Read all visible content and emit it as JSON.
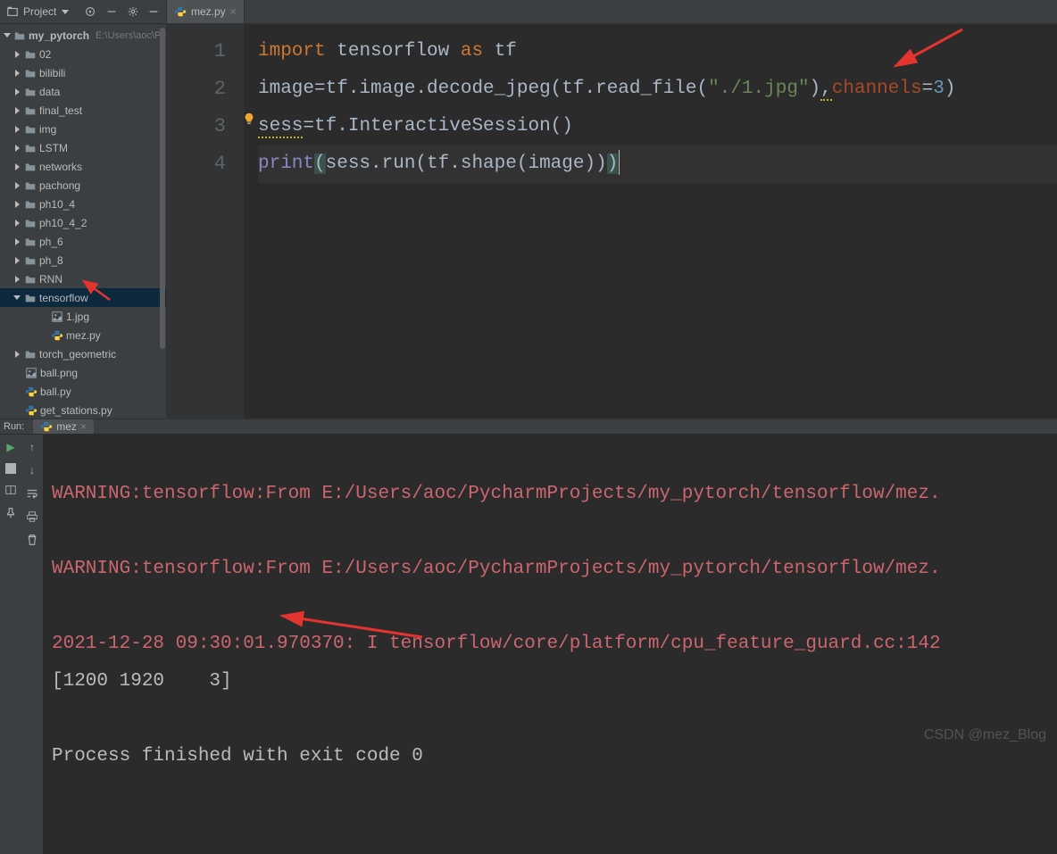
{
  "sidebar": {
    "headerLabel": "Project",
    "root": {
      "name": "my_pytorch",
      "path": "E:\\Users\\aoc\\Pyc"
    },
    "folders_root_level": [
      "02",
      "bilibili",
      "data",
      "final_test",
      "img",
      "LSTM",
      "networks",
      "pachong",
      "ph10_4",
      "ph10_4_2",
      "ph_6",
      "ph_8",
      "RNN"
    ],
    "tensorflow_folder": "tensorflow",
    "tensorflow_children": [
      "1.jpg",
      "mez.py"
    ],
    "torch_geo": "torch_geometric",
    "root_files": [
      "ball.png",
      "ball.py",
      "get_stations.py"
    ]
  },
  "tab": {
    "name": "mez.py"
  },
  "code": {
    "lines": [
      1,
      2,
      3,
      4
    ],
    "l1": {
      "kw_import": "import",
      "mod": "tensorflow",
      "kw_as": "as",
      "alias": "tf"
    },
    "l2": {
      "var": "image",
      "eq": "=",
      "call": "tf.image.decode_jpeg",
      "open": "(",
      "tfread": "tf.read_file",
      "op2": "(",
      "str": "\"./1.jpg\"",
      "cl2": ")",
      "comma": ",",
      "param": "channels",
      "eq2": "=",
      "num": "3",
      "cl": ")"
    },
    "l3": {
      "var": "sess",
      "eq": "=",
      "call": "tf.InteractiveSession()"
    },
    "l4": {
      "builtin": "print",
      "open": "(",
      "body": "sess.run(tf.shape(image))",
      "close": ")"
    }
  },
  "run": {
    "label": "Run:",
    "config": "mez",
    "lines": {
      "warn1": "WARNING:tensorflow:From E:/Users/aoc/PycharmProjects/my_pytorch/tensorflow/mez.",
      "warn2": "WARNING:tensorflow:From E:/Users/aoc/PycharmProjects/my_pytorch/tensorflow/mez.",
      "info": "2021-12-28 09:30:01.970370: I tensorflow/core/platform/cpu_feature_guard.cc:142",
      "out": "[1200 1920    3]",
      "exit": "Process finished with exit code 0"
    }
  },
  "watermark": "CSDN @mez_Blog"
}
